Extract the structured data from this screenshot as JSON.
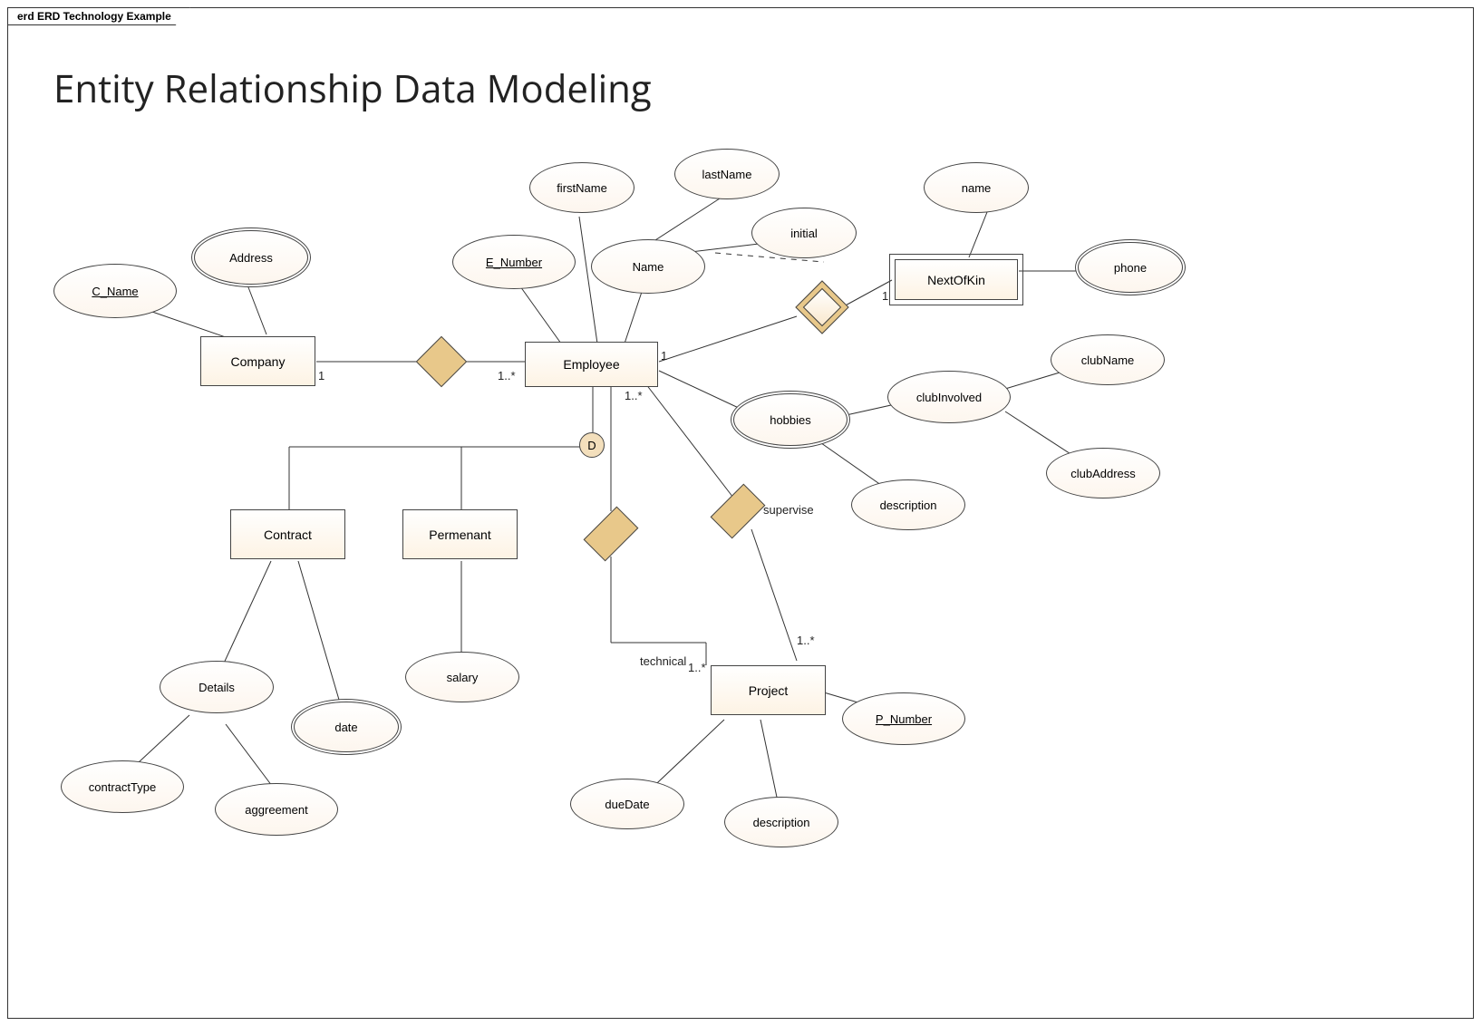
{
  "frame_title": "erd ERD Technology Example",
  "diagram_title": "Entity Relationship Data Modeling",
  "entities": {
    "company": "Company",
    "employee": "Employee",
    "nextofkin": "NextOfKin",
    "contract": "Contract",
    "permanent": "Permenant",
    "project": "Project"
  },
  "attributes": {
    "c_name": "C_Name",
    "address": "Address",
    "e_number": "E_Number",
    "firstName": "firstName",
    "lastName": "lastName",
    "initial": "initial",
    "name_comp": "Name",
    "nok_name": "name",
    "phone": "phone",
    "hobbies": "hobbies",
    "clubInvolved": "clubInvolved",
    "clubName": "clubName",
    "clubAddress": "clubAddress",
    "hob_desc": "description",
    "details": "Details",
    "date": "date",
    "contractType": "contractType",
    "aggreement": "aggreement",
    "salary": "salary",
    "p_number": "P_Number",
    "dueDate": "dueDate",
    "proj_desc": "description"
  },
  "D": "D",
  "labels": {
    "company_side": "1",
    "employee_side_company": "1..*",
    "employee_side_nok": "1",
    "nok_side": "1",
    "emp_proj_tech": "1..*",
    "proj_tech_side": "1..*",
    "proj_sup_side": "1..*",
    "technical": "technical",
    "supervise": "supervise"
  }
}
